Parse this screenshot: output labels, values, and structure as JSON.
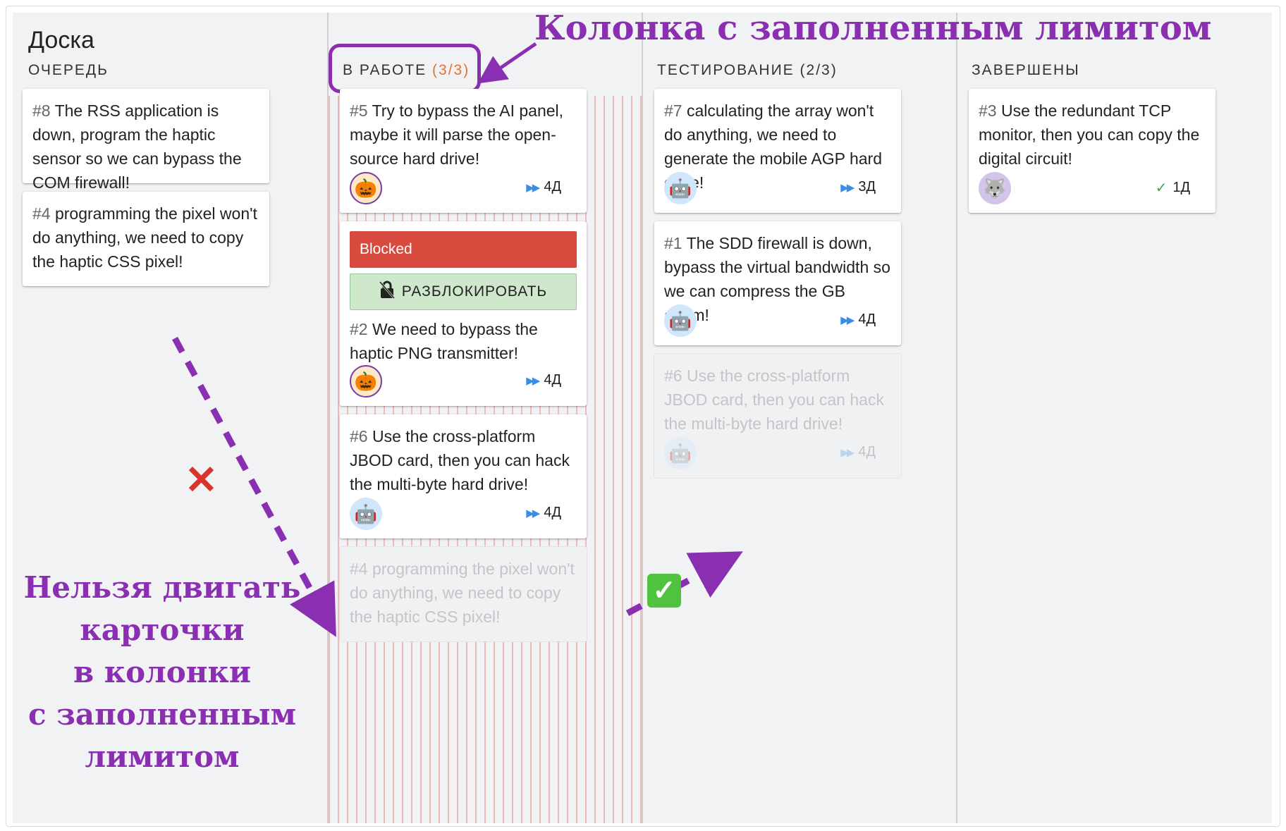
{
  "board": {
    "title": "Доска"
  },
  "columns": [
    {
      "title": "ОЧЕРЕДЬ",
      "limit": "",
      "cards": [
        {
          "num": "#8",
          "text": "The RSS application is down, program the haptic sensor so we can bypass the COM firewall!"
        },
        {
          "num": "#4",
          "text": "programming the pixel won't do anything, we need to copy the haptic CSS pixel!"
        }
      ]
    },
    {
      "title": "В РАБОТЕ",
      "limit": "(3/3)",
      "cards": [
        {
          "num": "#5",
          "text": "Try to bypass the AI panel, maybe it will parse the open-source hard drive!",
          "avatar": "pumpkin",
          "due": "4Д"
        },
        {
          "blocked_label": "Blocked",
          "unblock_label": "РАЗБЛОКИРОВАТЬ",
          "num": "#2",
          "text": "We need to bypass the haptic PNG transmitter!",
          "avatar": "pumpkin",
          "due": "4Д"
        },
        {
          "num": "#6",
          "text": "Use the cross-platform JBOD card, then you can hack the multi-byte hard drive!",
          "avatar": "robot",
          "due": "4Д"
        }
      ],
      "ghost_card": {
        "num": "#4",
        "text": "programming the pixel won't do anything, we need to copy the haptic CSS pixel!"
      }
    },
    {
      "title": "ТЕСТИРОВАНИЕ",
      "limit": "(2/3)",
      "cards": [
        {
          "num": "#7",
          "text": "calculating the array won't do anything, we need to generate the mobile AGP hard drive!",
          "avatar": "robot",
          "due": "3Д"
        },
        {
          "num": "#1",
          "text": "The SDD firewall is down, bypass the virtual bandwidth so we can compress the GB alarm!",
          "avatar": "robot",
          "due": "4Д"
        }
      ],
      "ghost_card": {
        "num": "#6",
        "text": "Use the cross-platform JBOD card, then you can hack the multi-byte hard drive!",
        "avatar": "robot",
        "due": "4Д"
      }
    },
    {
      "title": "ЗАВЕРШЕНЫ",
      "limit": "",
      "cards": [
        {
          "num": "#3",
          "text": "Use the redundant TCP monitor, then you can copy the digital circuit!",
          "avatar": "wolf",
          "due": "1Д"
        }
      ]
    }
  ],
  "annotations": {
    "top": "Колонка с заполненным лимитом",
    "left_lines": [
      "Нельзя двигать",
      "карточки",
      "в колонки",
      "с заполненным",
      "лимитом"
    ]
  },
  "icons": {
    "pumpkin": "pumpkin-avatar-icon",
    "robot": "robot-avatar-icon",
    "wolf": "wolf-avatar-icon",
    "lock": "lock-icon",
    "fast_forward": "fast-forward-icon",
    "check": "check-icon"
  },
  "colors": {
    "accent_purple": "#8a2fb1",
    "limit_orange": "#e3722f",
    "blocked_red": "#d94a3e",
    "unblock_green": "#cfe8cc",
    "due_blue": "#3a8ee6"
  }
}
